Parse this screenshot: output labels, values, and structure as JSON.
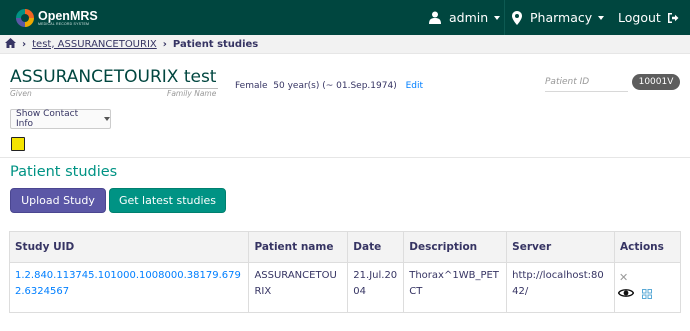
{
  "header": {
    "logo_name": "OpenMRS",
    "logo_tagline": "MEDICAL RECORD SYSTEM",
    "user": {
      "icon": "user-icon",
      "label": "admin"
    },
    "location": {
      "icon": "map-marker-icon",
      "label": "Pharmacy"
    },
    "logout": {
      "icon": "logout-icon",
      "label": "Logout"
    },
    "colors": {
      "bar": "#00463f"
    }
  },
  "breadcrumb": {
    "home_icon": "home-icon",
    "patient": "test, ASSURANCETOURIX",
    "current": "Patient studies"
  },
  "patient": {
    "name": "ASSURANCETOURIX test",
    "given_label": "Given",
    "family_label": "Family Name",
    "gender": "Female",
    "age": "50 year(s) (~ 01.Sep.1974)",
    "edit_label": "Edit",
    "id_label": "Patient ID",
    "id_value": "10001V",
    "contact_button": "Show Contact Info",
    "sticky_icon": "sticky-note-icon"
  },
  "page": {
    "title": "Patient studies",
    "upload_button": "Upload Study",
    "latest_button": "Get latest studies",
    "colors": {
      "title": "#009384",
      "upload": "#5b57a6",
      "latest": "#009384"
    }
  },
  "table": {
    "headers": [
      "Study UID",
      "Patient name",
      "Date",
      "Description",
      "Server",
      "Actions"
    ],
    "rows": [
      {
        "uid": "1.2.840.113745.101000.1008000.38179.6792.6324567",
        "patient_name": "ASSURANCETOURIX",
        "date": "21.Jul.2004",
        "description": "Thorax^1WB_PETCT",
        "server": "http://localhost:8042/",
        "actions": [
          "remove-icon",
          "view-icon",
          "grid-icon"
        ]
      }
    ]
  }
}
